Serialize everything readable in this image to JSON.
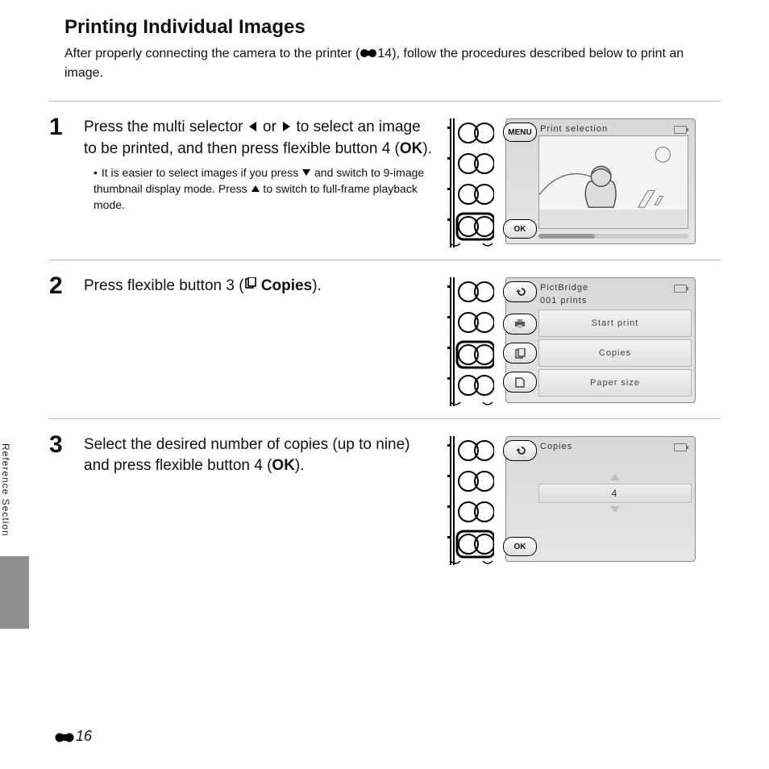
{
  "heading": "Printing Individual Images",
  "intro_a": "After properly connecting the camera to the printer (",
  "intro_ref": "14",
  "intro_b": "), follow the procedures described below to print an image.",
  "side_label": "Reference Section",
  "page_num": "16",
  "steps": {
    "s1": {
      "num": "1",
      "text_a": "Press the multi selector ",
      "text_b": " or ",
      "text_c": " to select an image to be printed, and then press flexible button 4 (",
      "ok": "OK",
      "text_d": ").",
      "bullet_a": "It is easier to select images if you press ",
      "bullet_b": " and switch to 9-image thumbnail display mode. Press ",
      "bullet_c": " to switch to full-frame playback mode.",
      "screen": {
        "header": "Print selection",
        "menu_label": "MENU",
        "ok_label": "OK"
      }
    },
    "s2": {
      "num": "2",
      "text_a": "Press flexible button 3 (",
      "copies_word": "Copies",
      "text_b": ").",
      "screen": {
        "header": "PictBridge",
        "sub": "001 prints",
        "item1": "Start print",
        "item2": "Copies",
        "item3": "Paper size"
      }
    },
    "s3": {
      "num": "3",
      "text_a": "Select the desired number of copies (up to nine) and press flexible button 4 (",
      "ok": "OK",
      "text_b": ").",
      "screen": {
        "header": "Copies",
        "value": "4",
        "ok_label": "OK"
      }
    }
  }
}
